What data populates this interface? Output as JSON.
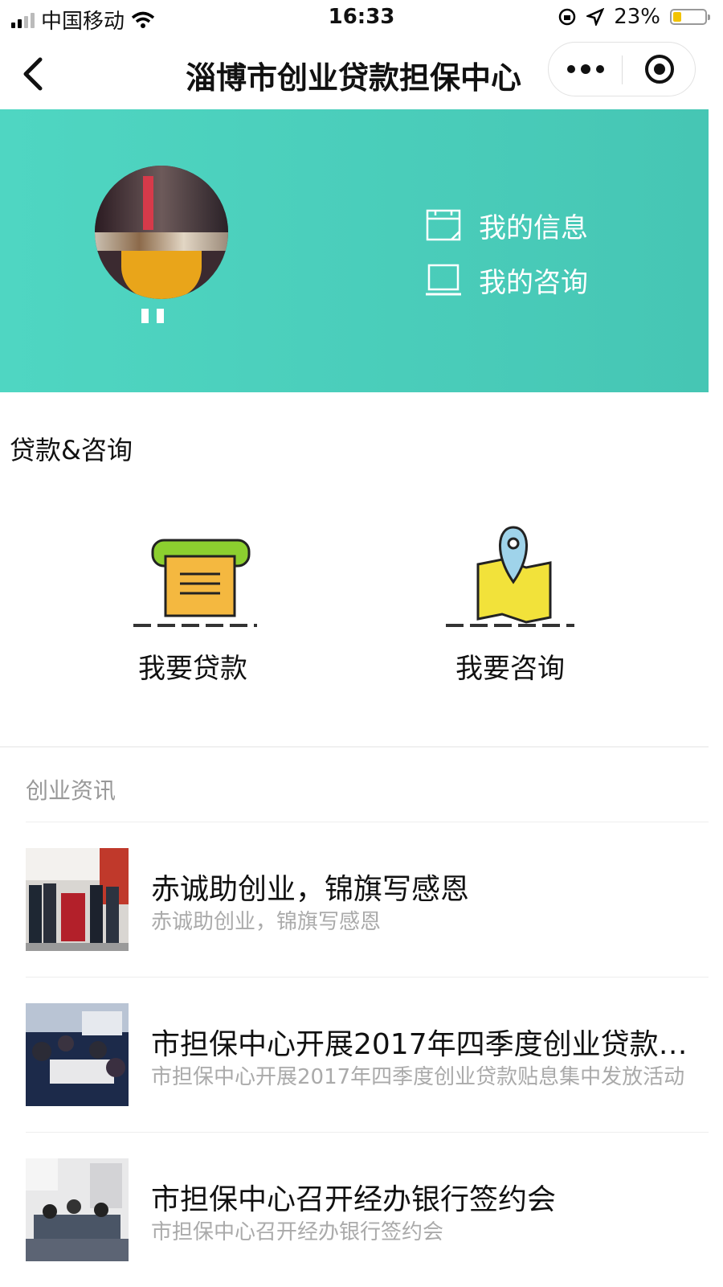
{
  "status_bar": {
    "carrier": "中国移动",
    "time": "16:33",
    "battery_pct": "23%"
  },
  "nav": {
    "title": "淄博市创业贷款担保中心"
  },
  "banner": {
    "links": [
      {
        "label": "我的信息",
        "icon": "calendar-icon"
      },
      {
        "label": "我的咨询",
        "icon": "laptop-icon"
      }
    ]
  },
  "loan_section": {
    "title": "贷款&咨询",
    "actions": [
      {
        "label": "我要贷款",
        "icon": "printer-loan-icon"
      },
      {
        "label": "我要咨询",
        "icon": "map-pin-icon"
      }
    ]
  },
  "news": {
    "heading": "创业资讯",
    "items": [
      {
        "title": "赤诚助创业，锦旗写感恩",
        "desc": "赤诚助创业，锦旗写感恩"
      },
      {
        "title": "市担保中心开展2017年四季度创业贷款贴息集中发放活动",
        "desc": "市担保中心开展2017年四季度创业贷款贴息集中发放活动"
      },
      {
        "title": "市担保中心召开经办银行签约会",
        "desc": "市担保中心召开经办银行签约会"
      }
    ]
  },
  "colors": {
    "banner": "#4fd6c2",
    "accent_yellow": "#f4c54a",
    "accent_green": "#8ccf2f"
  }
}
